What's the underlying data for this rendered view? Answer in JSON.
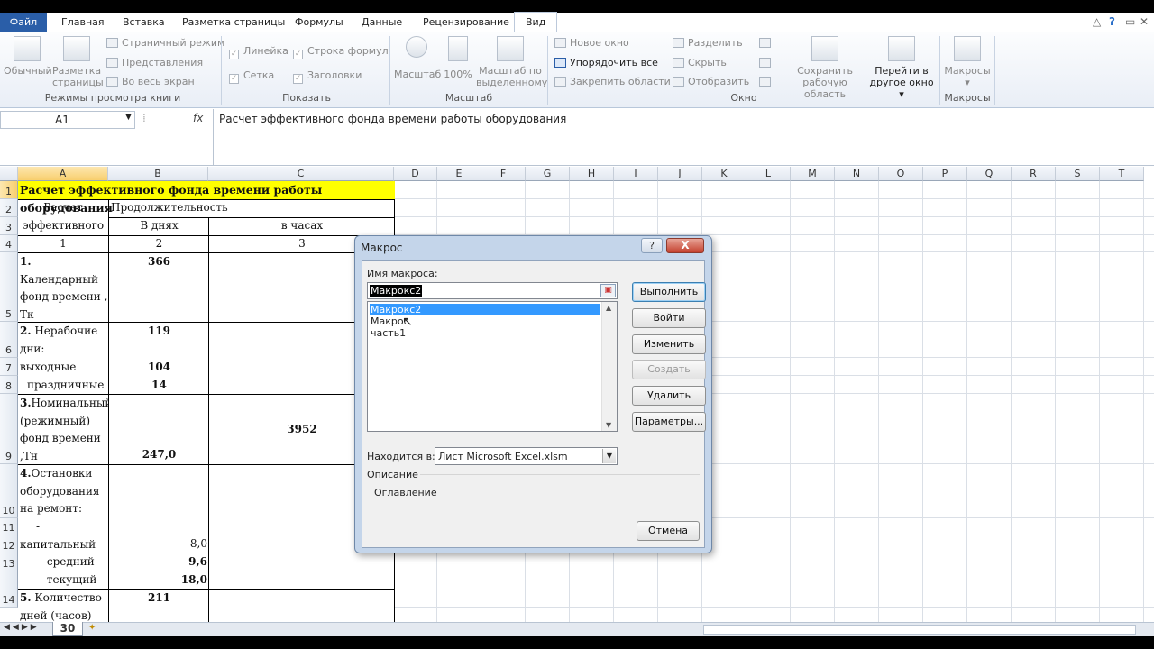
{
  "tabs": [
    {
      "label": "Файл",
      "name": "tab-file"
    },
    {
      "label": "Главная",
      "name": "tab-home"
    },
    {
      "label": "Вставка",
      "name": "tab-insert"
    },
    {
      "label": "Разметка страницы",
      "name": "tab-page-layout"
    },
    {
      "label": "Формулы",
      "name": "tab-formulas"
    },
    {
      "label": "Данные",
      "name": "tab-data"
    },
    {
      "label": "Рецензирование",
      "name": "tab-review"
    },
    {
      "label": "Вид",
      "name": "tab-view"
    }
  ],
  "ribbon": {
    "book_views": {
      "normal": "Обычный",
      "page_layout_1": "Разметка",
      "page_layout_2": "страницы",
      "page_break": "Страничный режим",
      "custom_views": "Представления",
      "full_screen": "Во весь экран",
      "label": "Режимы просмотра книги"
    },
    "show": {
      "ruler": "Линейка",
      "formula_bar": "Строка формул",
      "gridlines": "Сетка",
      "headings": "Заголовки",
      "label": "Показать"
    },
    "zoom": {
      "zoom": "Масштаб",
      "hundred": "100%",
      "to_selection_1": "Масштаб по",
      "to_selection_2": "выделенному",
      "label": "Масштаб"
    },
    "window": {
      "new_window": "Новое окно",
      "arrange_all": "Упорядочить все",
      "freeze_panes": "Закрепить области",
      "split": "Разделить",
      "hide": "Скрыть",
      "unhide": "Отобразить",
      "save_workspace_1": "Сохранить",
      "save_workspace_2": "рабочую область",
      "switch_windows_1": "Перейти в",
      "switch_windows_2": "другое окно",
      "label": "Окно"
    },
    "macros": {
      "macros": "Макросы",
      "label": "Макросы"
    }
  },
  "formula_bar": {
    "name_box": "A1",
    "fx": "fx",
    "formula": "Расчет эффективного фонда времени работы оборудования"
  },
  "columns": [
    "A",
    "B",
    "C",
    "D",
    "E",
    "F",
    "G",
    "H",
    "I",
    "J",
    "K",
    "L",
    "M",
    "N",
    "O",
    "P",
    "Q",
    "R",
    "S",
    "T"
  ],
  "rows": [
    "1",
    "2",
    "3",
    "4",
    "5",
    "6",
    "7",
    "8",
    "9",
    "10",
    "11",
    "12",
    "13",
    "14"
  ],
  "cells": {
    "a1": "Расчет эффективного фонда времени работы оборудования",
    "a2": "Расчет",
    "b2": "Продолжительность",
    "a3": "эффективного",
    "b3": "В днях",
    "c3": "в часах",
    "a4": "1",
    "b4": "2",
    "c4": "3",
    "a5_1": "1. Календарный",
    "a5_1_b": "1.",
    "a5_1_r": " Календарный",
    "a5_2": "фонд времени ,",
    "a5_3": "Тк",
    "b5": "366",
    "a6_1_b": "2.",
    "a6_1_r": " Нерабочие",
    "a6_2": "дни:",
    "b6": "119",
    "a7": "выходные",
    "b7": "104",
    "a8": "праздничные",
    "b8": "14",
    "a9_1": "3.Номинальный",
    "a9_1_b": "3.",
    "a9_1_r": "Номинальный",
    "a9_2": "(режимный)",
    "a9_3": "фонд времени",
    "a9_4": ",Тн",
    "b9": "247,0",
    "c9": "3952",
    "a10_1_b": "4.",
    "a10_1_r": "Остановки",
    "a10_2": "оборудования",
    "a10_3": "на ремонт:",
    "a11_1": "-",
    "a11_2": "капитальный",
    "b11": "8,0",
    "a12": "- средний",
    "b12": "9,6",
    "a13": "- текущий",
    "b13": "18,0",
    "a14_1_b": "5.",
    "a14_1_r": " Количество",
    "a14_2": "дней (часов)",
    "b14": "211"
  },
  "sheet_tab": "30",
  "dialog": {
    "title": "Макрос",
    "help": "?",
    "close": "X",
    "name_label": "Имя макроса:",
    "name_value": "Макрокс2",
    "list": [
      "Макрокс2",
      "Макрос",
      "часть1"
    ],
    "run": "Выполнить",
    "step_into": "Войти",
    "edit": "Изменить",
    "create": "Создать",
    "delete": "Удалить",
    "options": "Параметры...",
    "location_label": "Находится в:",
    "location_value": "Лист Microsoft Excel.xlsm",
    "description_label": "Описание",
    "description_value": "Оглавление",
    "cancel": "Отмена"
  }
}
